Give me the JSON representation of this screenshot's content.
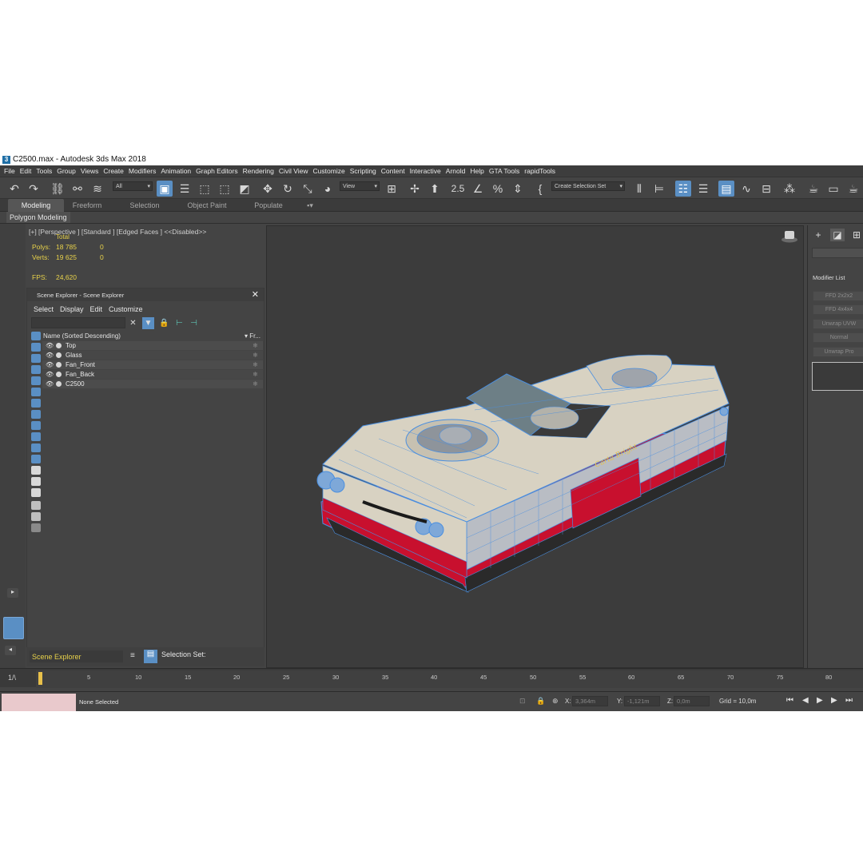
{
  "window": {
    "title": "C2500.max - Autodesk 3ds Max 2018",
    "icon": "3"
  },
  "menu": [
    "File",
    "Edit",
    "Tools",
    "Group",
    "Views",
    "Create",
    "Modifiers",
    "Animation",
    "Graph Editors",
    "Rendering",
    "Civil View",
    "Customize",
    "Scripting",
    "Content",
    "Interactive",
    "Arnold",
    "Help",
    "GTA Tools",
    "rapidTools"
  ],
  "toolbar": {
    "filter_value": "All",
    "ref_coord_value": "View",
    "selection_set_placeholder": "Create Selection Set",
    "snap_label": "2.5",
    "icons": [
      "undo-icon",
      "redo-icon",
      "link-icon",
      "unlink-icon",
      "bind-space-warp-icon",
      "select-object-icon",
      "select-by-name-icon",
      "rect-selection-icon",
      "window-crossing-icon",
      "move-icon",
      "rotate-icon",
      "scale-icon",
      "pivot-icon",
      "select-manipulate-icon",
      "keyboard-shortcut-icon",
      "snaps-toggle-icon",
      "angle-snap-icon",
      "percent-snap-icon",
      "spinner-snap-icon",
      "named-selection-icon",
      "mirror-icon",
      "align-icon",
      "scene-explorer-toggle-icon",
      "layer-explorer-icon",
      "ribbon-toggle-icon",
      "curve-editor-icon",
      "schematic-view-icon",
      "material-editor-icon",
      "render-setup-icon",
      "render-frame-icon",
      "render-icon"
    ]
  },
  "ribbon": {
    "tabs": [
      "Modeling",
      "Freeform",
      "Selection",
      "Object Paint",
      "Populate"
    ],
    "active_tab": "Modeling",
    "subtab": "Polygon Modeling"
  },
  "viewport": {
    "label": "[+] [Perspective ]  [Standard ]  [Edged Faces ]  <<Disabled>>",
    "stats": {
      "total_label": "Total",
      "polys_label": "Polys:",
      "polys_total": "18 785",
      "polys_selected": "0",
      "verts_label": "Verts:",
      "verts_total": "19 625",
      "verts_selected": "0",
      "fps_label": "FPS:",
      "fps_value": "24,620"
    },
    "car_script": "Carta Bright",
    "colors": {
      "body": "#d8d2c2",
      "stripe": "#c8102e",
      "wire": "#4a8fe0"
    }
  },
  "scene_explorer": {
    "title": "Scene Explorer - Scene Explorer",
    "menu": [
      "Select",
      "Display",
      "Edit",
      "Customize"
    ],
    "column_name": "Name (Sorted Descending)",
    "column_frozen": "▾ Fr...",
    "rows": [
      "Top",
      "Glass",
      "Fan_Front",
      "Fan_Back",
      "C2500"
    ]
  },
  "command_panel": {
    "modifier_list_label": "Modifier List",
    "modifiers": [
      "FFD 2x2x2",
      "FFD 4x4x4",
      "Unwrap UVW",
      "Normal",
      "Unwrap Pro"
    ]
  },
  "bottom": {
    "explorer_dropdown": "Scene Explorer",
    "selection_set_label": "Selection Set:",
    "frame_indicator": "1/\\"
  },
  "timeline": {
    "ticks": [
      "5",
      "10",
      "15",
      "20",
      "25",
      "30",
      "35",
      "40",
      "45",
      "50",
      "55",
      "60",
      "65",
      "70",
      "75",
      "80"
    ]
  },
  "status": {
    "selection": "None Selected",
    "x_label": "X:",
    "x_value": "3,364m",
    "y_label": "Y:",
    "y_value": "-1,121m",
    "z_label": "Z:",
    "z_value": "0,0m",
    "grid": "Grid = 10,0m"
  }
}
